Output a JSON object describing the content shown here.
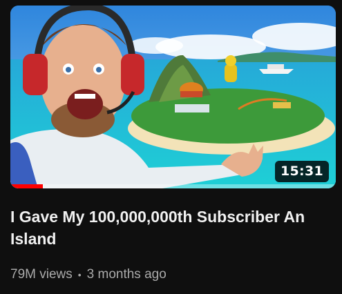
{
  "video": {
    "title": "I Gave My 100,000,000th Subscriber An Island",
    "duration": "15:31",
    "views": "79M views",
    "separator": "•",
    "age": "3 months ago",
    "watch_progress": 0.1
  },
  "colors": {
    "background": "#0f0f0f",
    "title_text": "#f1f1f1",
    "meta_text": "#aaaaaa",
    "progress_fill": "#ff0000"
  }
}
